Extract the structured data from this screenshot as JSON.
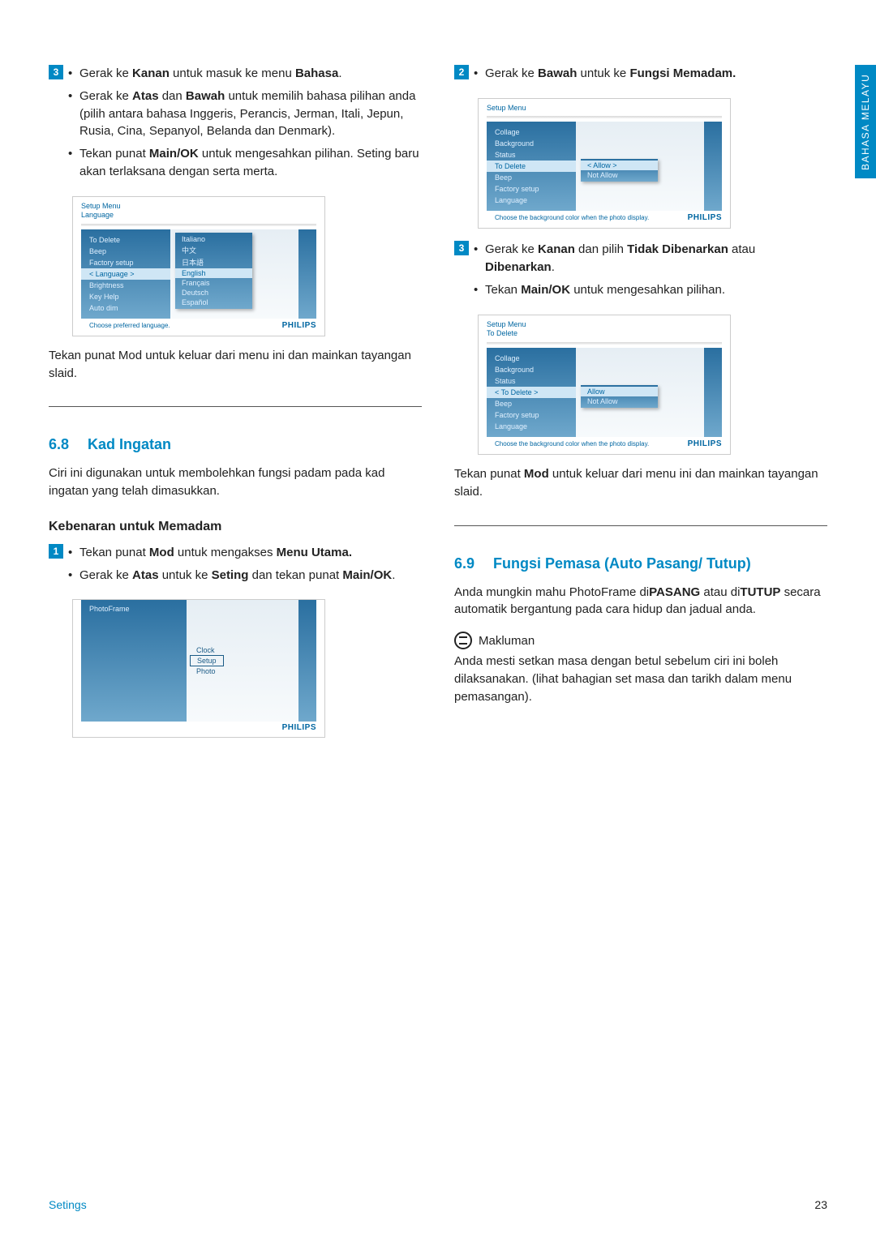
{
  "sideTab": "BAHASA MELAYU",
  "left": {
    "step3": {
      "num": "3",
      "b1a": "Gerak ke ",
      "b1b": "Kanan",
      "b1c": " untuk masuk ke menu ",
      "b1d": "Bahasa",
      "b1e": ".",
      "b2a": "Gerak ke ",
      "b2b": "Atas",
      "b2c": " dan ",
      "b2d": "Bawah",
      "b2e": " untuk memilih bahasa pilihan anda (pilih antara bahasa Inggeris, Perancis, Jerman, Itali, Jepun, Rusia, Cina, Sepanyol, Belanda dan Denmark).",
      "b3a": "Tekan punat ",
      "b3b": "Main/OK",
      "b3c": " untuk mengesahkan pilihan. Seting baru akan terlaksana dengan serta merta."
    },
    "screenLang": {
      "bc1": "Setup Menu",
      "bc2": "Language",
      "left": [
        "To Delete",
        "Beep",
        "Factory setup",
        "< Language >",
        "Brightness",
        "Key Help",
        "Auto dim"
      ],
      "leftHlIdx": 3,
      "drop": [
        "Italiano",
        "中文",
        "日本語",
        "English",
        "Français",
        "Deutsch",
        "Español"
      ],
      "dropHlIdx": 3,
      "cap": "Choose preferred language.",
      "brand": "PHILIPS"
    },
    "afterLang": "Tekan punat Mod untuk keluar dari menu ini dan mainkan tayangan slaid.",
    "sec68": {
      "num": "6.8",
      "title": "Kad Ingatan"
    },
    "sec68body": "Ciri ini digunakan untuk membolehkan fungsi padam pada kad ingatan yang telah dimasukkan.",
    "sub68": "Kebenaran untuk Memadam",
    "step1": {
      "num": "1",
      "b1a": "Tekan punat ",
      "b1b": "Mod",
      "b1c": " untuk mengakses ",
      "b1d": "Menu Utama.",
      "b2a": "Gerak ke ",
      "b2b": "Atas",
      "b2c": " untuk ke ",
      "b2d": "Seting",
      "b2e": " dan tekan punat ",
      "b2f": "Main/OK",
      "b2g": "."
    },
    "screenPF": {
      "bc1": "PhotoFrame",
      "mid": [
        "Clock",
        "Setup",
        "Photo"
      ],
      "midBoxIdx": 1,
      "brand": "PHILIPS"
    }
  },
  "right": {
    "step2": {
      "num": "2",
      "b1a": "Gerak ke ",
      "b1b": "Bawah",
      "b1c": " untuk ke ",
      "b1d": "Fungsi Memadam."
    },
    "screenDel1": {
      "bc1": "Setup Menu",
      "left": [
        "Collage",
        "Background",
        "Status",
        "To Delete",
        "Beep",
        "Factory setup",
        "Language"
      ],
      "leftHlIdx": 3,
      "drop": [
        "< Allow >",
        "Not Allow"
      ],
      "dropHlIdx": 0,
      "cap": "Choose the background color when the photo display.",
      "brand": "PHILIPS"
    },
    "step3": {
      "num": "3",
      "b1a": "Gerak ke ",
      "b1b": "Kanan",
      "b1c": " dan pilih ",
      "b1d": "Tidak Dibenarkan",
      "b1e": " atau ",
      "b1f": "Dibenarkan",
      "b1g": ".",
      "b2a": "Tekan ",
      "b2b": "Main/OK",
      "b2c": " untuk mengesahkan pilihan."
    },
    "screenDel2": {
      "bc1": "Setup Menu",
      "bc2": "To Delete",
      "left": [
        "Collage",
        "Background",
        "Status",
        "< To Delete >",
        "Beep",
        "Factory setup",
        "Language"
      ],
      "leftHlIdx": 3,
      "drop": [
        "Allow",
        "Not Allow"
      ],
      "dropHlIdx": 0,
      "cap": "Choose the background color when the photo display.",
      "brand": "PHILIPS"
    },
    "afterDel": {
      "a": "Tekan punat ",
      "b": "Mod",
      "c": " untuk keluar dari menu ini dan mainkan tayangan slaid."
    },
    "sec69": {
      "num": "6.9",
      "title": "Fungsi Pemasa (Auto Pasang/ Tutup)"
    },
    "sec69body": {
      "a": "Anda mungkin mahu PhotoFrame di",
      "b": "PASANG",
      "c": " atau di",
      "d": "TUTUP",
      "e": " secara automatik bergantung pada cara hidup dan jadual anda."
    },
    "noteLabel": "Makluman",
    "noteBody": "Anda mesti setkan masa dengan betul sebelum ciri ini boleh dilaksanakan. (lihat bahagian set masa dan tarikh dalam menu pemasangan)."
  },
  "footer": {
    "left": "Setings",
    "right": "23"
  }
}
